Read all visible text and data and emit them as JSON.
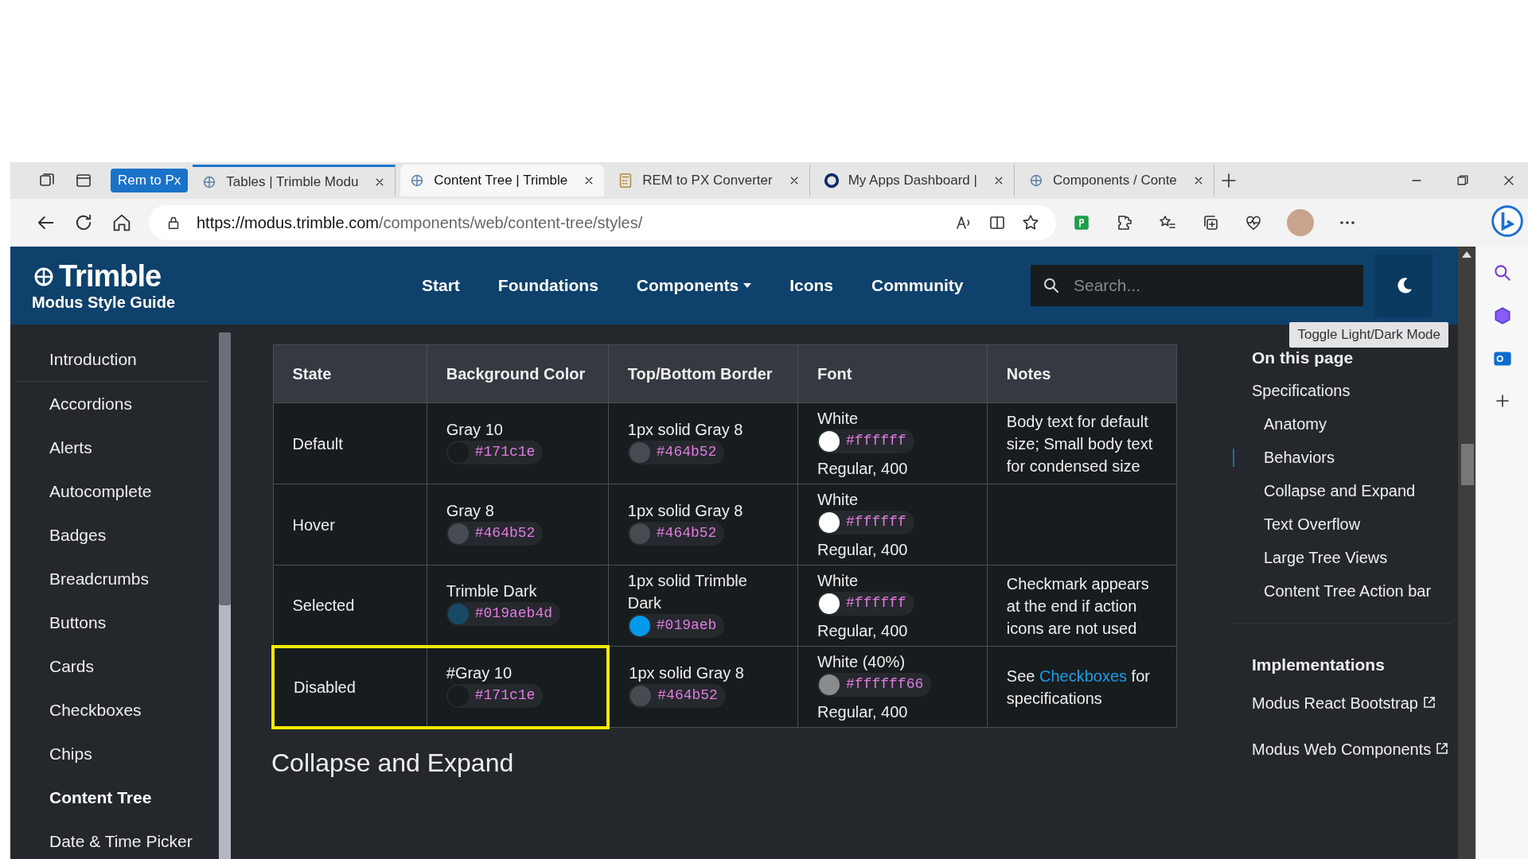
{
  "browser": {
    "tab_group": "Rem to Px",
    "tabs": [
      {
        "label": "Tables | Trimble Modu",
        "selected": false,
        "kind": "trimble"
      },
      {
        "label": "Content Tree | Trimble",
        "selected": true,
        "kind": "trimble"
      },
      {
        "label": "REM to PX Converter",
        "selected": false,
        "kind": "calc"
      },
      {
        "label": "My Apps Dashboard |",
        "selected": false,
        "kind": "ring"
      },
      {
        "label": "Components / Conte",
        "selected": false,
        "kind": "trimble"
      }
    ],
    "url_domain": "https://modus.trimble.com",
    "url_path": "/components/web/content-tree/styles/"
  },
  "header": {
    "brand": "Trimble",
    "subtitle": "Modus Style Guide",
    "nav": [
      {
        "label": "Start",
        "dropdown": false
      },
      {
        "label": "Foundations",
        "dropdown": false
      },
      {
        "label": "Components",
        "dropdown": true
      },
      {
        "label": "Icons",
        "dropdown": false
      },
      {
        "label": "Community",
        "dropdown": false
      }
    ],
    "search": {
      "placeholder": "Search..."
    },
    "tooltip": "Toggle Light/Dark Mode"
  },
  "sidebar": {
    "items": [
      {
        "label": "Introduction",
        "selected": false
      },
      {
        "label": "Accordions",
        "selected": false
      },
      {
        "label": "Alerts",
        "selected": false
      },
      {
        "label": "Autocomplete",
        "selected": false
      },
      {
        "label": "Badges",
        "selected": false
      },
      {
        "label": "Breadcrumbs",
        "selected": false
      },
      {
        "label": "Buttons",
        "selected": false
      },
      {
        "label": "Cards",
        "selected": false
      },
      {
        "label": "Checkboxes",
        "selected": false
      },
      {
        "label": "Chips",
        "selected": false
      },
      {
        "label": "Content Tree",
        "selected": true
      },
      {
        "label": "Date & Time Picker",
        "selected": false
      }
    ]
  },
  "table": {
    "columns": [
      "State",
      "Background Color",
      "Top/Bottom Border",
      "Font",
      "Notes"
    ],
    "rows": [
      {
        "state": "Default",
        "highlighted": false,
        "background": {
          "name": "Gray 10",
          "hex": "#171c1e",
          "color": "#171c1e"
        },
        "border": {
          "name": "1px solid Gray 8",
          "hex": "#464b52",
          "color": "#464b52"
        },
        "font": {
          "name": "White",
          "hex": "#ffffff",
          "color": "#ffffff",
          "weight": "Regular, 400"
        },
        "notes": [
          {
            "kind": "text",
            "text": "Body text for default size; Small body text for condensed size"
          }
        ]
      },
      {
        "state": "Hover",
        "highlighted": false,
        "background": {
          "name": "Gray 8",
          "hex": "#464b52",
          "color": "#464b52"
        },
        "border": {
          "name": "1px solid Gray 8",
          "hex": "#464b52",
          "color": "#464b52"
        },
        "font": {
          "name": "White",
          "hex": "#ffffff",
          "color": "#ffffff",
          "weight": "Regular, 400"
        },
        "notes": []
      },
      {
        "state": "Selected",
        "highlighted": false,
        "background": {
          "name": "Trimble Dark",
          "hex": "#019aeb4d",
          "color": "#174a66"
        },
        "border": {
          "name": "1px solid Trimble Dark",
          "hex": "#019aeb",
          "color": "#019aeb"
        },
        "font": {
          "name": "White",
          "hex": "#ffffff",
          "color": "#ffffff",
          "weight": "Regular, 400"
        },
        "notes": [
          {
            "kind": "text",
            "text": "Checkmark appears at the end if action icons are not used"
          }
        ]
      },
      {
        "state": "Disabled",
        "highlighted": true,
        "background": {
          "name": "#Gray 10",
          "hex": "#171c1e",
          "color": "#171c1e"
        },
        "border": {
          "name": "1px solid Gray 8",
          "hex": "#464b52",
          "color": "#464b52"
        },
        "font": {
          "name": "White (40%)",
          "hex": "#ffffff66",
          "color": "#8a8b8c",
          "weight": "Regular, 400"
        },
        "notes": [
          {
            "kind": "text",
            "text": "See "
          },
          {
            "kind": "link",
            "text": "Checkboxes"
          },
          {
            "kind": "text",
            "text": " for specifications"
          }
        ]
      }
    ]
  },
  "section_heading": "Collapse and Expand",
  "toc": {
    "title": "On this page",
    "items": [
      {
        "label": "Specifications",
        "selected": false,
        "children": [
          {
            "label": "Anatomy",
            "selected": false
          },
          {
            "label": "Behaviors",
            "selected": true
          },
          {
            "label": "Collapse and Expand",
            "selected": false
          },
          {
            "label": "Text Overflow",
            "selected": false
          },
          {
            "label": "Large Tree Views",
            "selected": false
          },
          {
            "label": "Content Tree Action bar",
            "selected": false
          }
        ]
      }
    ],
    "implementations_title": "Implementations",
    "implementations": [
      "Modus React Bootstrap",
      "Modus Web Components"
    ]
  }
}
